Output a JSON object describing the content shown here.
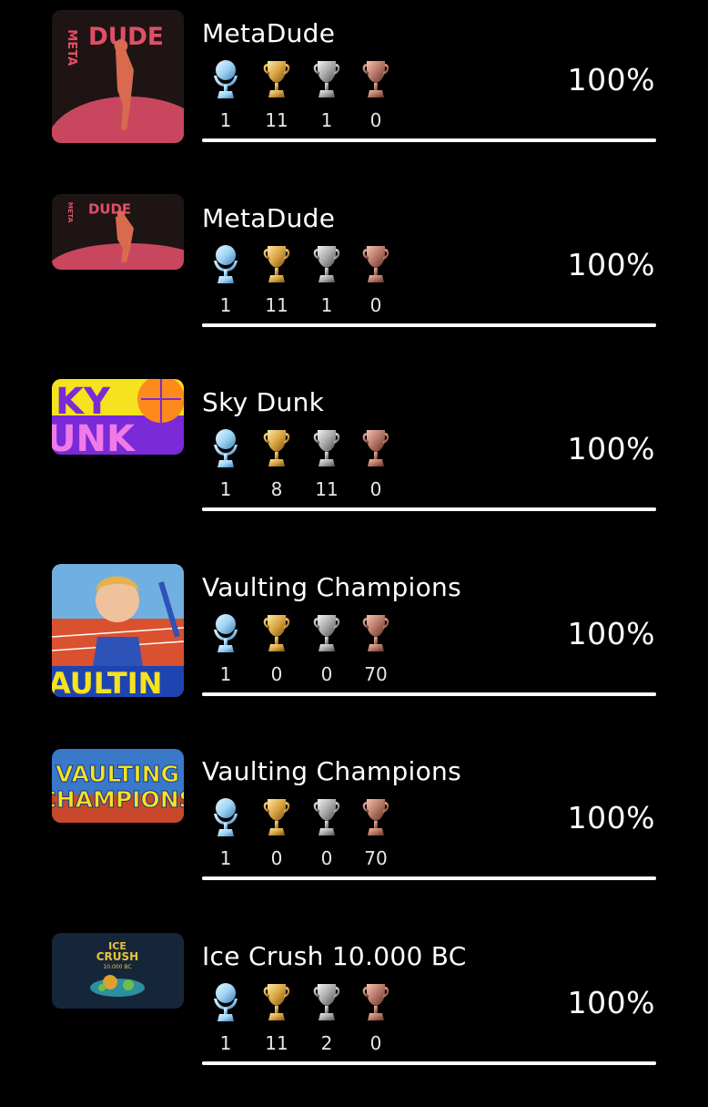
{
  "games": [
    {
      "title": "MetaDude",
      "platinum": 1,
      "gold": 11,
      "silver": 1,
      "bronze": 0,
      "completion": "100%",
      "progress": 1.0,
      "art": {
        "logo_text": "DUDE",
        "side_text": "META"
      }
    },
    {
      "title": "MetaDude",
      "platinum": 1,
      "gold": 11,
      "silver": 1,
      "bronze": 0,
      "completion": "100%",
      "progress": 1.0,
      "art": {
        "logo_text": "DUDE",
        "side_text": "META"
      }
    },
    {
      "title": "Sky Dunk",
      "platinum": 1,
      "gold": 8,
      "silver": 11,
      "bronze": 0,
      "completion": "100%",
      "progress": 1.0,
      "art": {
        "line1": "KY",
        "line2": "UNK"
      }
    },
    {
      "title": "Vaulting Champions",
      "platinum": 1,
      "gold": 0,
      "silver": 0,
      "bronze": 70,
      "completion": "100%",
      "progress": 1.0,
      "art": {
        "banner": "AULTIN"
      }
    },
    {
      "title": "Vaulting Champions",
      "platinum": 1,
      "gold": 0,
      "silver": 0,
      "bronze": 70,
      "completion": "100%",
      "progress": 1.0,
      "art": {
        "line1": "VAULTING",
        "line2": "CHAMPIONS"
      }
    },
    {
      "title": "Ice Crush 10.000 BC",
      "platinum": 1,
      "gold": 11,
      "silver": 2,
      "bronze": 0,
      "completion": "100%",
      "progress": 1.0,
      "art": {
        "line1": "ICE",
        "line2": "CRUSH",
        "line3": "10.000 BC"
      }
    }
  ],
  "trophy_icons": [
    "platinum-trophy-icon",
    "gold-trophy-icon",
    "silver-trophy-icon",
    "bronze-trophy-icon"
  ],
  "colors": {
    "background": "#000000",
    "platinum": "#9fd4f4",
    "gold": "#d9a441",
    "silver": "#a9a9a9",
    "bronze": "#b87766",
    "progress": "#ffffff"
  }
}
